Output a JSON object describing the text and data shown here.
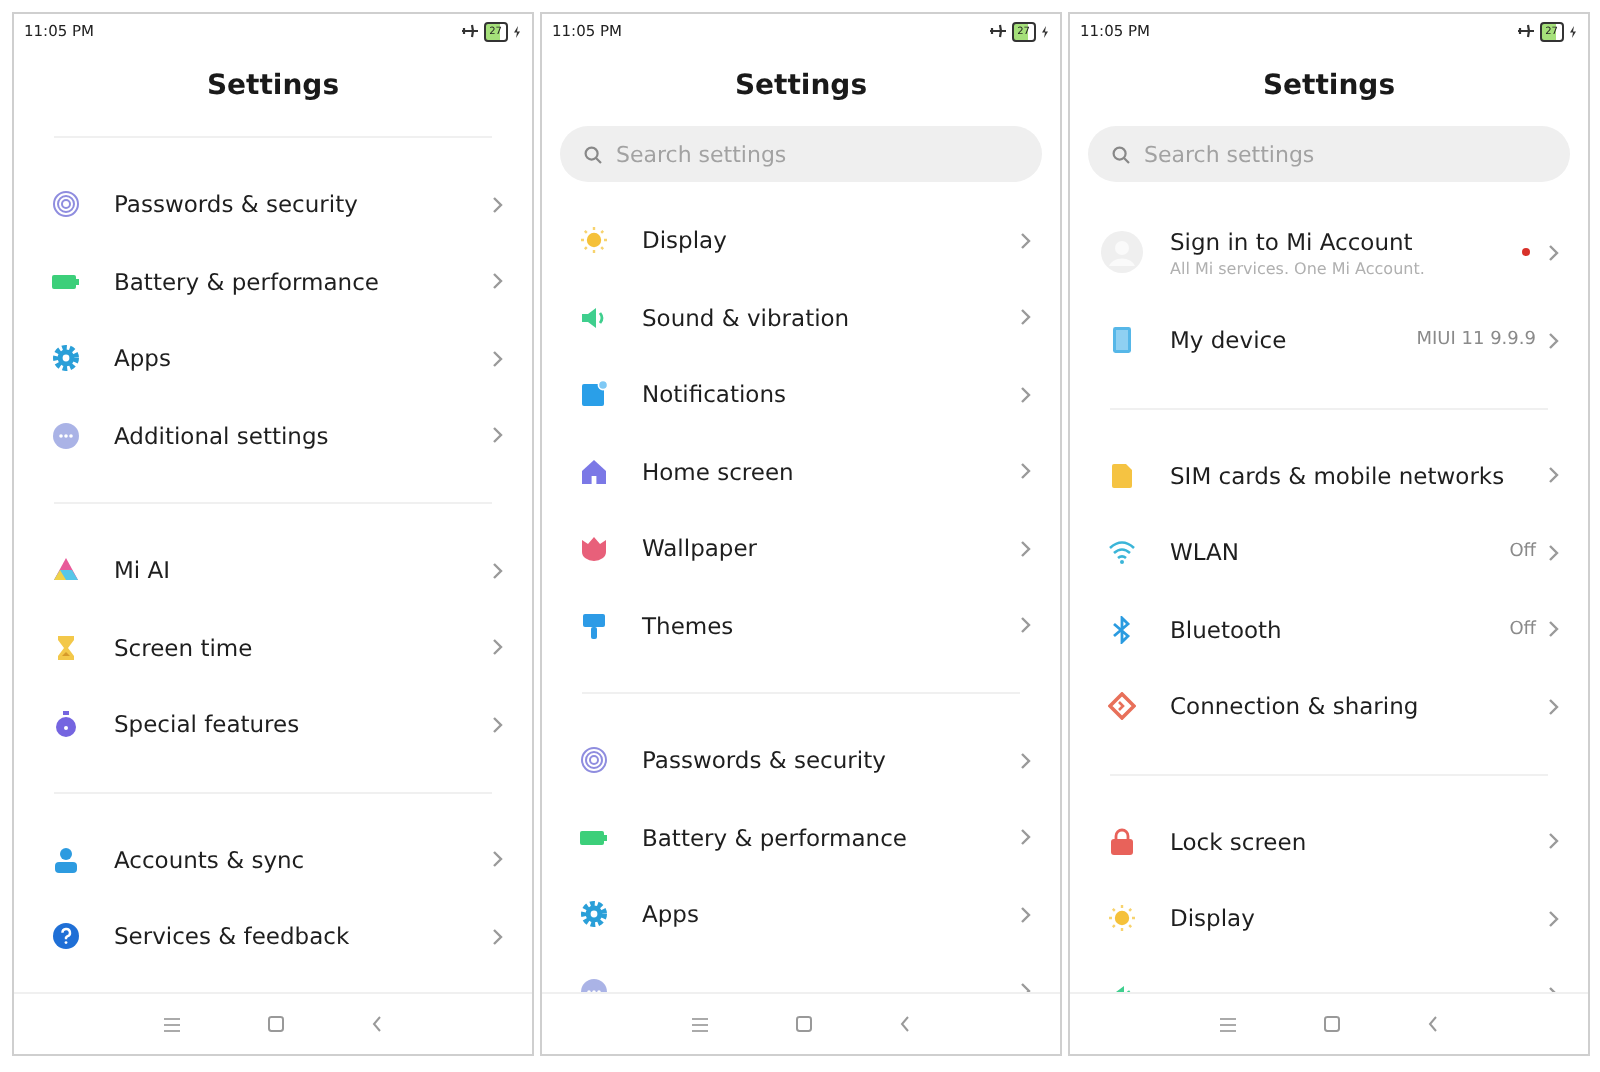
{
  "phones": [
    {
      "status_bar": {
        "time": "11:05 PM",
        "battery": "27"
      },
      "title": "Settings",
      "groups": [
        [
          {
            "kind": "fingerprint",
            "label": "Passwords & security"
          },
          {
            "kind": "battery",
            "label": "Battery & performance"
          },
          {
            "kind": "gear",
            "label": "Apps"
          },
          {
            "kind": "more",
            "label": "Additional settings"
          }
        ],
        [
          {
            "kind": "ai",
            "label": "Mi AI"
          },
          {
            "kind": "hourglass",
            "label": "Screen time"
          },
          {
            "kind": "stopwatch",
            "label": "Special features"
          }
        ],
        [
          {
            "kind": "person",
            "label": "Accounts & sync"
          },
          {
            "kind": "help",
            "label": "Services & feedback"
          }
        ]
      ]
    },
    {
      "status_bar": {
        "time": "11:05 PM",
        "battery": "27"
      },
      "title": "Settings",
      "search": {
        "placeholder": "Search settings"
      },
      "groups": [
        [
          {
            "kind": "sun",
            "label": "Display"
          },
          {
            "kind": "speaker",
            "label": "Sound & vibration"
          },
          {
            "kind": "notification",
            "label": "Notifications"
          },
          {
            "kind": "home",
            "label": "Home screen"
          },
          {
            "kind": "tulip",
            "label": "Wallpaper"
          },
          {
            "kind": "brush",
            "label": "Themes"
          }
        ],
        [
          {
            "kind": "fingerprint",
            "label": "Passwords & security"
          },
          {
            "kind": "battery",
            "label": "Battery & performance"
          },
          {
            "kind": "gear",
            "label": "Apps"
          },
          {
            "kind": "more"
          }
        ]
      ]
    },
    {
      "status_bar": {
        "time": "11:05 PM",
        "battery": "27"
      },
      "title": "Settings",
      "search": {
        "placeholder": "Search settings"
      },
      "groups": [
        [
          {
            "kind": "account",
            "label": "Sign in to Mi Account",
            "subtitle": "All Mi services. One Mi Account.",
            "notification_dot": true
          },
          {
            "kind": "device",
            "label": "My device",
            "value": "MIUI 11 9.9.9"
          }
        ],
        [
          {
            "kind": "sim",
            "label": "SIM cards & mobile networks"
          },
          {
            "kind": "wifi",
            "label": "WLAN",
            "value": "Off"
          },
          {
            "kind": "bluetooth",
            "label": "Bluetooth",
            "value": "Off"
          },
          {
            "kind": "connection",
            "label": "Connection & sharing"
          }
        ],
        [
          {
            "kind": "lock",
            "label": "Lock screen"
          },
          {
            "kind": "sun",
            "label": "Display"
          },
          {
            "kind": "speaker"
          }
        ]
      ]
    }
  ]
}
